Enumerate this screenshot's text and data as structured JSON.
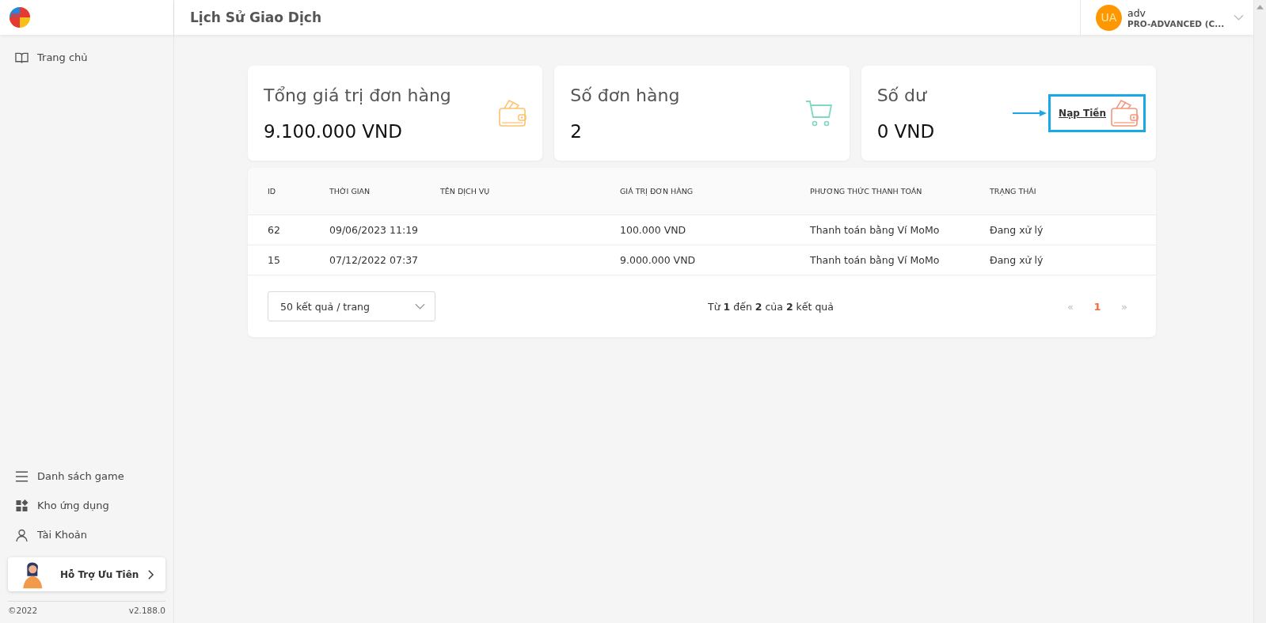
{
  "header": {
    "title": "Lịch Sử Giao Dịch",
    "user": {
      "initials": "UA",
      "name": "adv",
      "plan": "PRO-ADVANCED (C..."
    }
  },
  "sidebar": {
    "top_items": [
      {
        "label": "Trang chủ",
        "kind": "book"
      }
    ],
    "bottom_items": [
      {
        "label": "Danh sách game",
        "kind": "menu"
      },
      {
        "label": "Kho ứng dụng",
        "kind": "apps"
      },
      {
        "label": "Tài Khoản",
        "kind": "user"
      }
    ],
    "support": {
      "label": "Hỗ Trợ Ưu Tiên"
    },
    "footer": {
      "copyright": "©2022",
      "version": "v2.188.0"
    }
  },
  "stats": [
    {
      "kind": "wallet",
      "title": "Tổng giá trị đơn hàng",
      "value": "9.100.000 VND"
    },
    {
      "kind": "cart",
      "title": "Số đơn hàng",
      "value": "2"
    },
    {
      "kind": "topup",
      "title": "Số dư",
      "value": "0 VND",
      "link": "Nạp Tiền"
    }
  ],
  "table": {
    "columns": [
      "ID",
      "THỜI GIAN",
      "TÊN DỊCH VỤ",
      "GIÁ TRỊ ĐƠN HÀNG",
      "PHƯƠNG THỨC THANH TOÁN",
      "TRẠNG THÁI"
    ],
    "rows": [
      [
        "62",
        "09/06/2023 11:19",
        "",
        "100.000 VND",
        "Thanh toán bằng Ví MoMo",
        "Đang xử lý"
      ],
      [
        "15",
        "07/12/2022 07:37",
        "",
        "9.000.000 VND",
        "Thanh toán bằng Ví MoMo",
        "Đang xử lý"
      ]
    ]
  },
  "pagination": {
    "page_size": "50 kết quả / trang",
    "summary": "Từ **1** đến **2** của **2** kết quả",
    "prev": "«",
    "next": "»",
    "pages": [
      {
        "label": "1",
        "selected": true
      }
    ]
  }
}
